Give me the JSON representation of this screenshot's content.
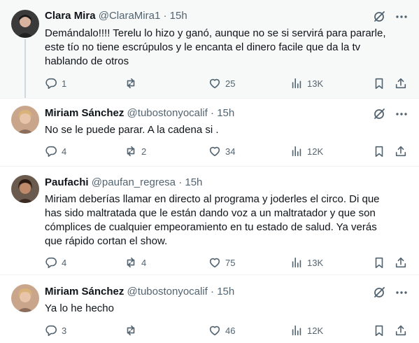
{
  "tweets": [
    {
      "name": "Clara Mira",
      "handle": "@ClaraMira1",
      "dot": "·",
      "time": "15h",
      "text": "Demándalo!!!! Terelu lo hizo y ganó, aunque no se si servirá para pararle, este tío no tiene escrúpulos y le encanta el dinero facile que da la tv hablando de otros",
      "replies": "1",
      "retweets": "",
      "likes": "25",
      "views": "13K"
    },
    {
      "name": "Miriam Sánchez",
      "handle": "@tubostonyocalif",
      "dot": "·",
      "time": "15h",
      "text": "No se le puede parar. A la cadena si .",
      "replies": "4",
      "retweets": "2",
      "likes": "34",
      "views": "12K"
    },
    {
      "name": "Paufachi",
      "handle": "@paufan_regresa",
      "dot": "·",
      "time": "15h",
      "text": "Miriam deberías llamar en directo al programa y joderles el circo. Di que has sido maltratada que le están dando voz a un maltratador y que son cómplices de cualquier empeoramiento en tu estado de salud. Ya verás que rápido cortan el show.",
      "replies": "4",
      "retweets": "4",
      "likes": "75",
      "views": "13K"
    },
    {
      "name": "Miriam Sánchez",
      "handle": "@tubostonyocalif",
      "dot": "·",
      "time": "15h",
      "text": "Ya lo he hecho",
      "replies": "3",
      "retweets": "",
      "likes": "46",
      "views": "12K"
    }
  ],
  "icons": {
    "top": [
      "grok-icon",
      "more-icon"
    ],
    "actions": [
      "reply-icon",
      "retweet-icon",
      "like-icon",
      "views-icon",
      "bookmark-icon",
      "share-icon"
    ]
  },
  "colors": {
    "text": "#0f1419",
    "secondary": "#536471",
    "highlight_bg": "#f7f9f9",
    "divider": "#eff3f4",
    "thread_line": "#cfd9de"
  }
}
